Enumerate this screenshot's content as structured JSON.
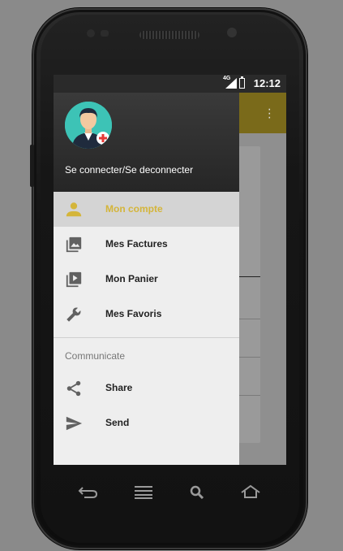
{
  "status_bar": {
    "time": "12:12",
    "network": "4G"
  },
  "drawer": {
    "header_label": "Se connecter/Se deconnecter",
    "items": [
      {
        "label": "Mon compte",
        "icon": "person-icon",
        "active": true
      },
      {
        "label": "Mes Factures",
        "icon": "photo-library-icon"
      },
      {
        "label": "Mon Panier",
        "icon": "video-library-icon"
      },
      {
        "label": "Mes Favoris",
        "icon": "wrench-icon"
      }
    ],
    "section_title": "Communicate",
    "section_items": [
      {
        "label": "Share",
        "icon": "share-icon"
      },
      {
        "label": "Send",
        "icon": "send-icon"
      }
    ]
  },
  "colors": {
    "accent": "#d4b53a",
    "toolbar": "#7a6a1a",
    "avatar_bg": "#3dc3b6"
  }
}
